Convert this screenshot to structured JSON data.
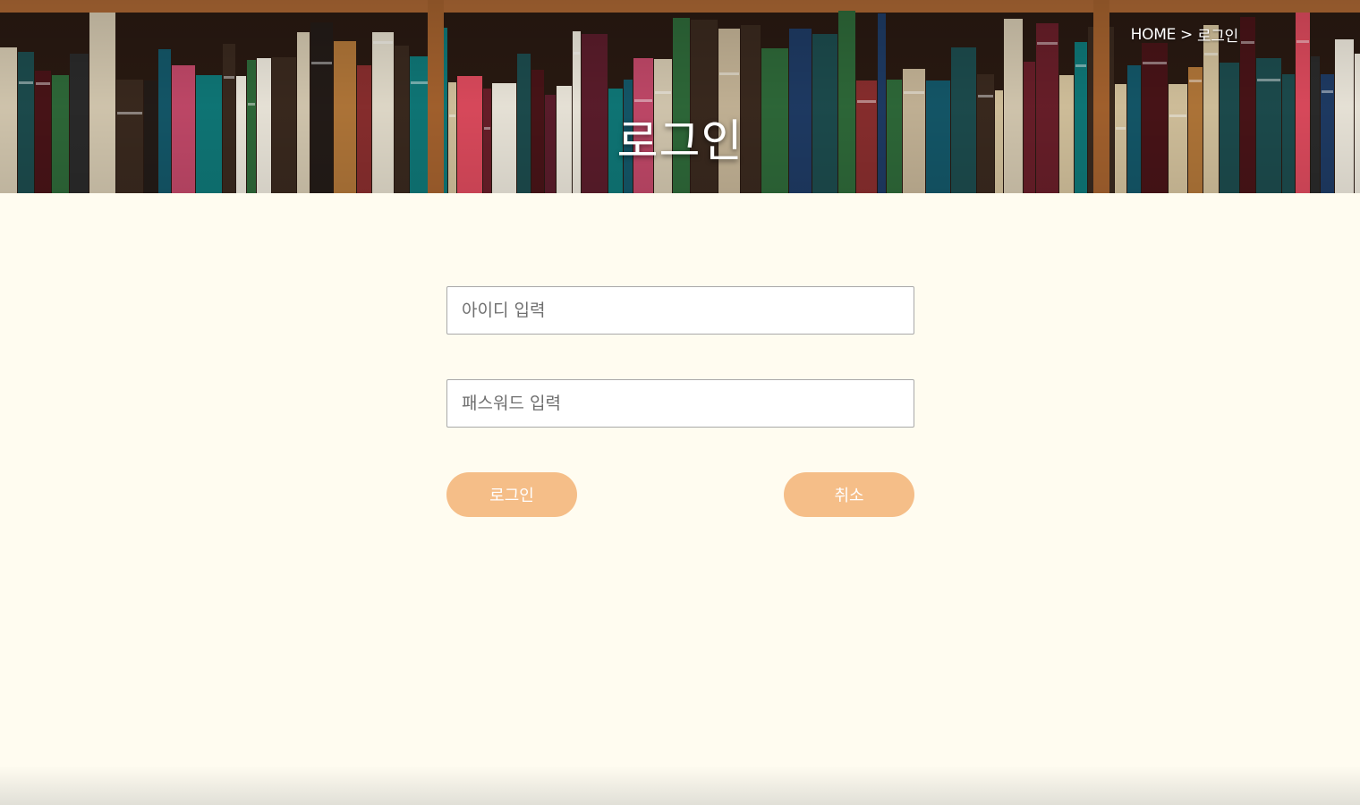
{
  "hero": {
    "title": "로그인",
    "breadcrumb": {
      "home": "HOME",
      "separator": ">",
      "current": "로그인"
    }
  },
  "form": {
    "id_placeholder": "아이디 입력",
    "id_value": "",
    "password_placeholder": "패스워드 입력",
    "password_value": "",
    "login_label": "로그인",
    "cancel_label": "취소"
  },
  "colors": {
    "page_background": "#fffcf0",
    "button": "#f5be88",
    "button_text": "#ffffff",
    "hero_text": "#ffffff"
  }
}
